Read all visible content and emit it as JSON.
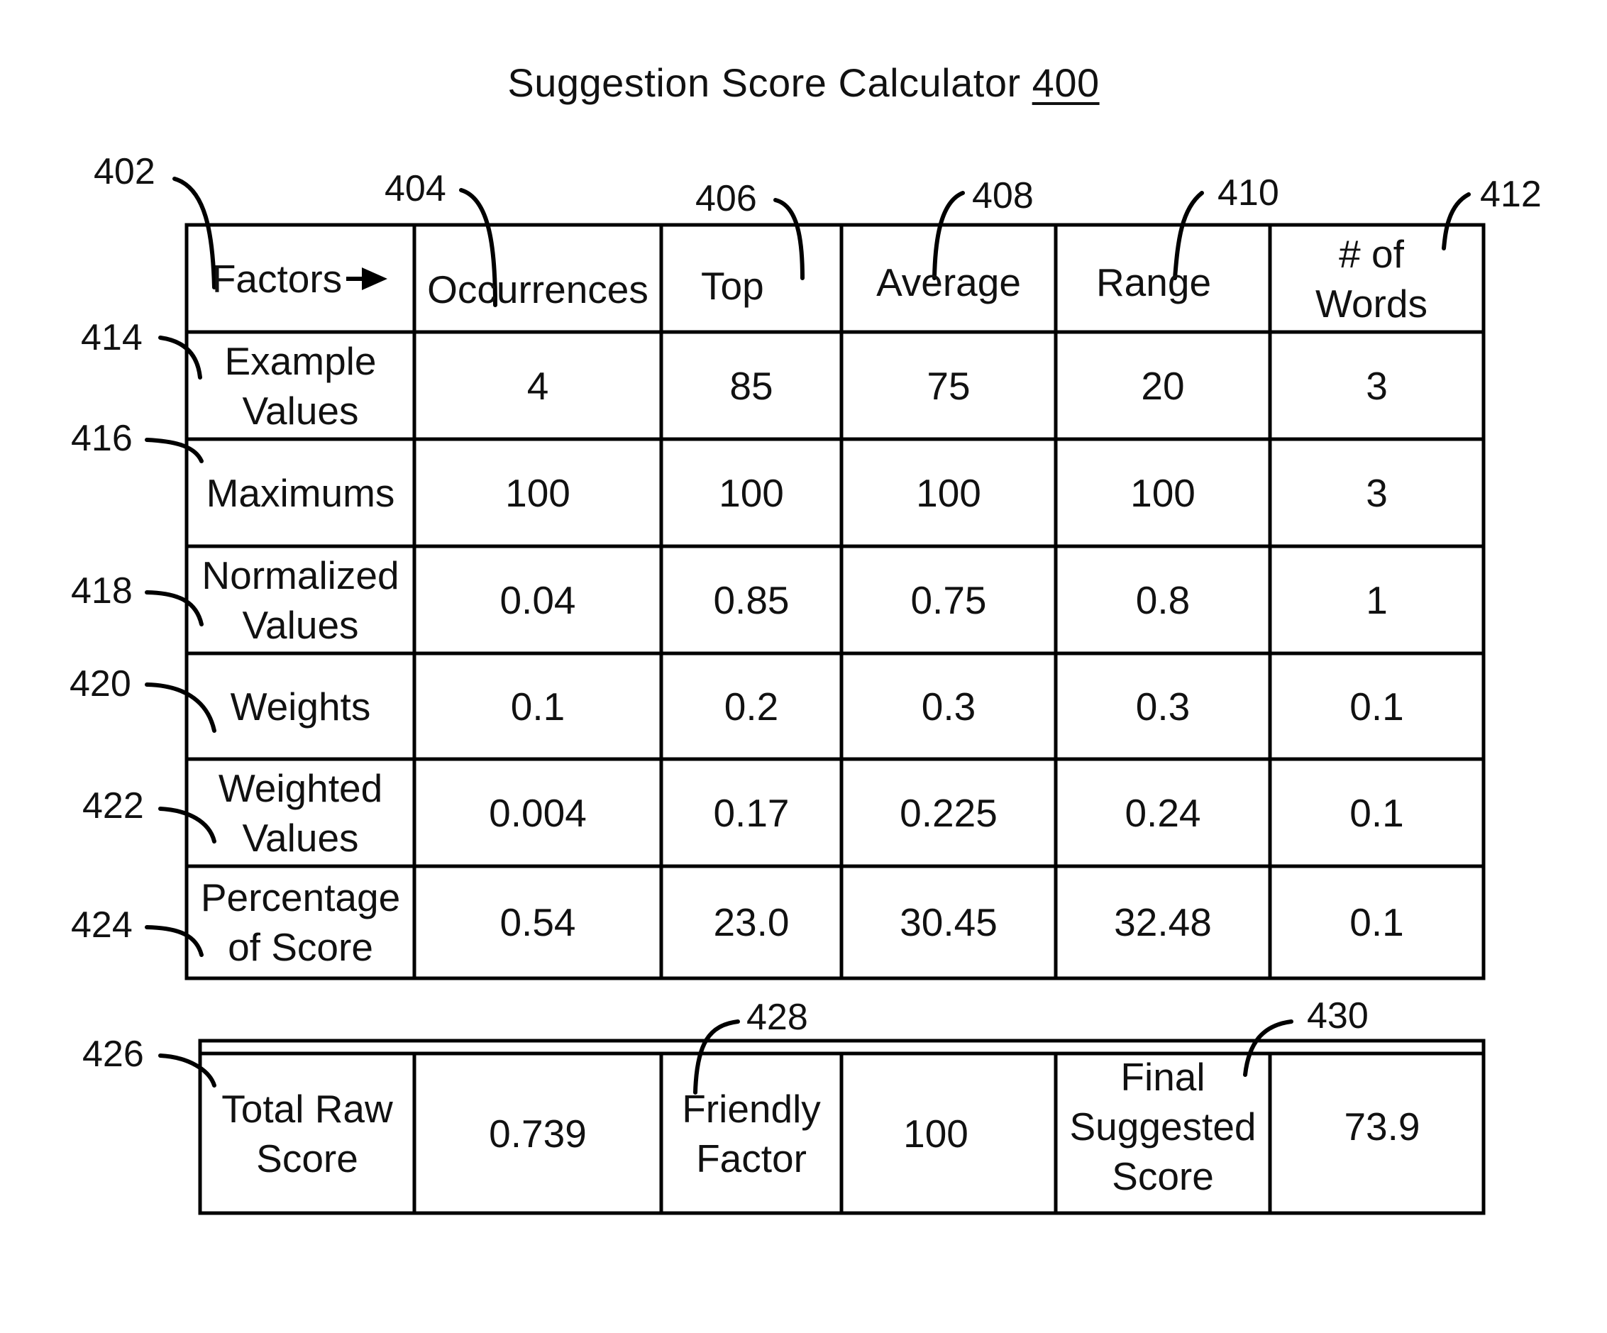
{
  "title": {
    "text": "Suggestion Score Calculator ",
    "number": "400"
  },
  "header": {
    "factors_label": "Factors",
    "columns": [
      "Occurrences",
      "Top",
      "Average",
      "Range",
      "# of\nWords"
    ]
  },
  "rows": [
    {
      "label": "Example\nValues",
      "values": [
        "4",
        "85",
        "75",
        "20",
        "3"
      ]
    },
    {
      "label": "Maximums",
      "values": [
        "100",
        "100",
        "100",
        "100",
        "3"
      ]
    },
    {
      "label": "Normalized\nValues",
      "values": [
        "0.04",
        "0.85",
        "0.75",
        "0.8",
        "1"
      ]
    },
    {
      "label": "Weights",
      "values": [
        "0.1",
        "0.2",
        "0.3",
        "0.3",
        "0.1"
      ]
    },
    {
      "label": "Weighted\nValues",
      "values": [
        "0.004",
        "0.17",
        "0.225",
        "0.24",
        "0.1"
      ]
    },
    {
      "label": "Percentage\nof Score",
      "values": [
        "0.54",
        "23.0",
        "30.45",
        "32.48",
        "0.1"
      ]
    }
  ],
  "summary": {
    "total_raw_label": "Total Raw\nScore",
    "total_raw_value": "0.739",
    "friendly_label": "Friendly\nFactor",
    "friendly_value": "100",
    "final_label": "Final\nSuggested\nScore",
    "final_value": "73.9"
  },
  "refs": {
    "factors": "402",
    "occurrences": "404",
    "top": "406",
    "average": "408",
    "range": "410",
    "words": "412",
    "example": "414",
    "maximums": "416",
    "normalized": "418",
    "weights": "420",
    "weighted": "422",
    "percentage": "424",
    "total_raw": "426",
    "friendly": "428",
    "final": "430"
  },
  "icons": {
    "factors_arrow": "right-arrow-icon"
  }
}
